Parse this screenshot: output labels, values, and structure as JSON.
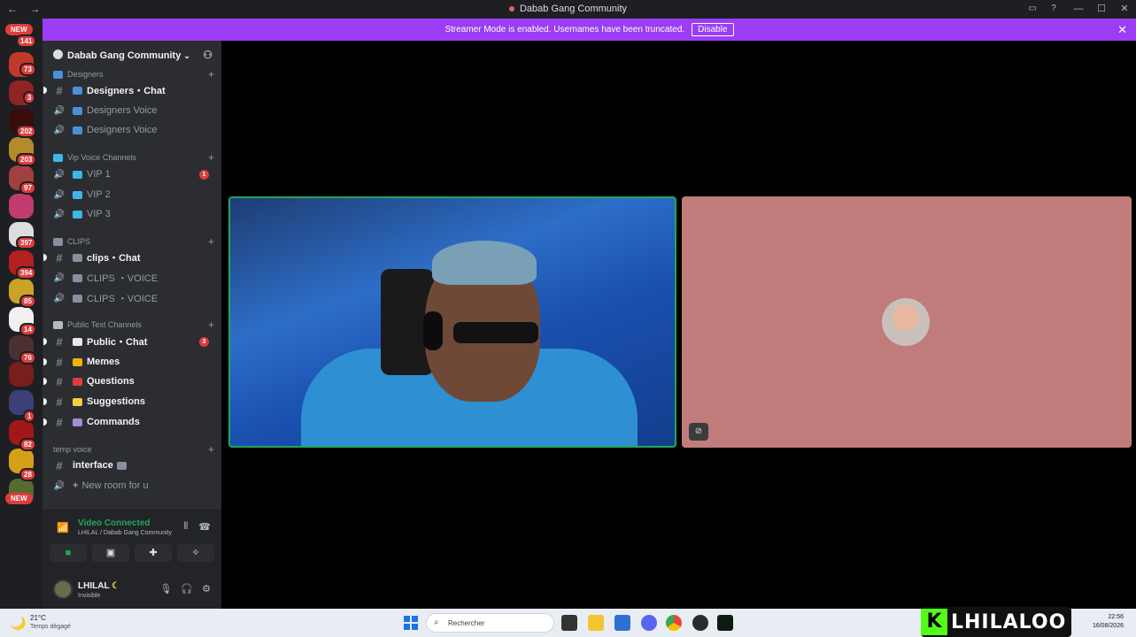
{
  "window": {
    "title": "Dabab Gang Community",
    "back": "←",
    "forward": "→",
    "minimize": "—",
    "maximize": "☐",
    "close": "✕"
  },
  "banner": {
    "text": "Streamer Mode is enabled. Usernames have been truncated.",
    "disable_label": "Disable",
    "close": "✕"
  },
  "guilds": {
    "new_top": "NEW",
    "new_bottom": "NEW",
    "badges": [
      "141",
      "73",
      "3",
      "202",
      "203",
      "97",
      "397",
      "394",
      "85",
      "14",
      "76",
      "1",
      "82",
      "28"
    ]
  },
  "server": {
    "name": "Dabab Gang Community",
    "categories": [
      {
        "label": "Designers"
      },
      {
        "label": "Vip Voice Channels"
      },
      {
        "label": "CLIPS"
      },
      {
        "label": "Public Text Channels"
      },
      {
        "label": "temp voice"
      }
    ],
    "channels": {
      "designers_chat": "Designers・Chat",
      "designers_voice_1": "Designers Voice",
      "designers_voice_2": "Designers Voice",
      "vip1": "VIP 1",
      "vip1_badge": "1",
      "vip2": "VIP 2",
      "vip3": "VIP 3",
      "clips_chat": "clips・Chat",
      "clips_voice_1": "CLIPS ・VOICE",
      "clips_voice_2": "CLIPS ・VOICE",
      "public_chat": "Public・Chat",
      "public_badge": "3",
      "memes": "Memes",
      "questions": "Questions",
      "suggestions": "Suggestions",
      "commands": "Commands",
      "interface": "interface",
      "new_room": "New room for u"
    }
  },
  "voice": {
    "status": "Video Connected",
    "location": "LHILAL / Dabab Gang Community"
  },
  "user": {
    "name": "LHILAL",
    "status": "Invisible"
  },
  "taskbar": {
    "temp": "21°C",
    "condition": "Temps dégagé",
    "search_placeholder": "Rechercher",
    "time": "22:56",
    "date": "16/08/2026"
  },
  "watermark": {
    "letter": "K",
    "text": "LHILALOO"
  },
  "colors": {
    "accent": "#9b3df5",
    "connected": "#23a55a",
    "badge": "#e03c3c",
    "tile_bg": "#c07b7b"
  }
}
